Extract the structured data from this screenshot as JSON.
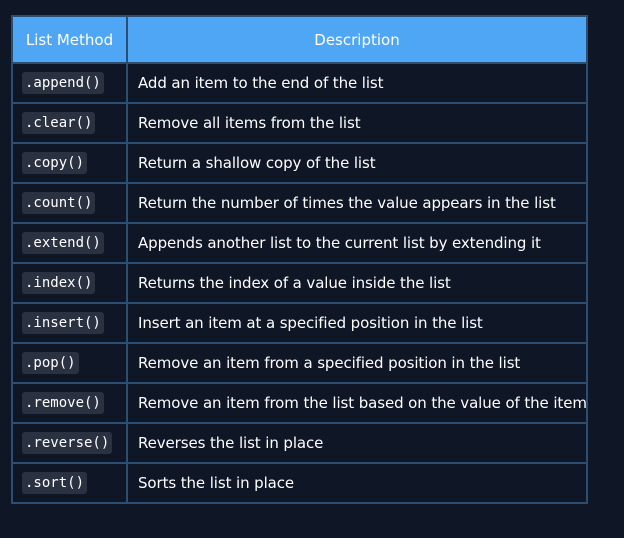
{
  "table": {
    "headers": {
      "method": "List Method",
      "description": "Description"
    },
    "rows": [
      {
        "method": ".append()",
        "description": "Add an item to the end of the list"
      },
      {
        "method": ".clear()",
        "description": "Remove all items from the list"
      },
      {
        "method": ".copy()",
        "description": "Return a shallow copy of the list"
      },
      {
        "method": ".count()",
        "description": "Return the number of times the value appears in the list"
      },
      {
        "method": ".extend()",
        "description": "Appends another list to the current list by extending it"
      },
      {
        "method": ".index()",
        "description": "Returns the index of a value inside the list"
      },
      {
        "method": ".insert()",
        "description": "Insert an item at a specified position in the list"
      },
      {
        "method": ".pop()",
        "description": "Remove an item from a specified position in the list"
      },
      {
        "method": ".remove()",
        "description": "Remove an item from the list based on the value of the item"
      },
      {
        "method": ".reverse()",
        "description": "Reverses the list in place"
      },
      {
        "method": ".sort()",
        "description": "Sorts the list in place"
      }
    ]
  },
  "colors": {
    "background": "#0f1626",
    "header": "#4fa6f5",
    "border": "#2b4f72",
    "code_bg": "#2a3140"
  }
}
